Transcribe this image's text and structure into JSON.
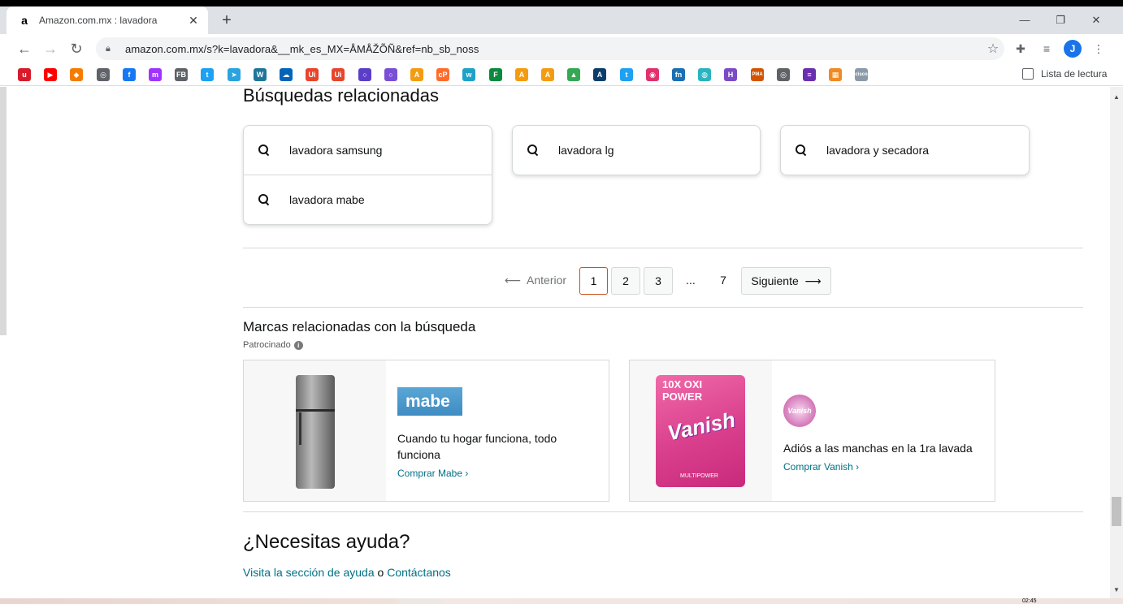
{
  "browser": {
    "tab_title": "Amazon.com.mx : lavadora",
    "tab_favicon": "a",
    "url": "amazon.com.mx/s?k=lavadora&__mk_es_MX=ÅMÅŽÕÑ&ref=nb_sb_noss",
    "profile_initial": "J",
    "reading_list": "Lista de lectura",
    "bookmarks": [
      {
        "label": "u",
        "color": "#d81b2b"
      },
      {
        "label": "▶",
        "color": "#ff0000"
      },
      {
        "label": "◆",
        "color": "#f57c00"
      },
      {
        "label": "◎",
        "color": "#5f6368"
      },
      {
        "label": "f",
        "color": "#1877f2"
      },
      {
        "label": "m",
        "color": "#a033ff"
      },
      {
        "label": "FB",
        "color": "#5f6368"
      },
      {
        "label": "t",
        "color": "#1da1f2"
      },
      {
        "label": "➤",
        "color": "#2aa3de"
      },
      {
        "label": "W",
        "color": "#21759b"
      },
      {
        "label": "☁",
        "color": "#0364b8"
      },
      {
        "label": "Ui",
        "color": "#e8452c"
      },
      {
        "label": "Ui",
        "color": "#e8452c"
      },
      {
        "label": "○",
        "color": "#5b3ec8"
      },
      {
        "label": "○",
        "color": "#7a4fd6"
      },
      {
        "label": "A",
        "color": "#f39c12"
      },
      {
        "label": "cP",
        "color": "#ff6c2c"
      },
      {
        "label": "w",
        "color": "#1fa2c7"
      },
      {
        "label": "F",
        "color": "#0b8a3e"
      },
      {
        "label": "A",
        "color": "#f39c12"
      },
      {
        "label": "A",
        "color": "#f39c12"
      },
      {
        "label": "▲",
        "color": "#34a853"
      },
      {
        "label": "A",
        "color": "#0b3d6b"
      },
      {
        "label": "t",
        "color": "#1da1f2"
      },
      {
        "label": "◉",
        "color": "#e1306c"
      },
      {
        "label": "fn",
        "color": "#1b6fb3"
      },
      {
        "label": "◍",
        "color": "#2bb3c0"
      },
      {
        "label": "H",
        "color": "#7b4ac7"
      },
      {
        "label": "PMA",
        "color": "#d35400"
      },
      {
        "label": "◎",
        "color": "#5f6368"
      },
      {
        "label": "≡",
        "color": "#6a2fb0"
      },
      {
        "label": "▦",
        "color": "#f08a24"
      },
      {
        "label": "cisco",
        "color": "#8a9aa8"
      }
    ]
  },
  "page": {
    "related_searches_heading": "Búsquedas relacionadas",
    "related_searches": [
      "lavadora samsung",
      "lavadora mabe",
      "lavadora lg",
      "lavadora y secadora"
    ],
    "pagination": {
      "prev": "Anterior",
      "pages": [
        "1",
        "2",
        "3"
      ],
      "ellipsis": "...",
      "last": "7",
      "next": "Siguiente",
      "current": "1"
    },
    "brands": {
      "title": "Marcas relacionadas con la búsqueda",
      "sponsored": "Patrocinado",
      "cards": [
        {
          "logo_text": "mabe",
          "tagline": "Cuando tu hogar funciona, todo funciona",
          "link": "Comprar Mabe ›"
        },
        {
          "logo_text": "Vanish",
          "tagline": "Adiós a las manchas en la 1ra lavada",
          "link": "Comprar Vanish ›"
        }
      ],
      "vanish_pack_top": "10X OXI POWER",
      "vanish_pack_word": "Vanish",
      "vanish_pack_sub": "MULTIPOWER"
    },
    "help": {
      "title": "¿Necesitas ayuda?",
      "link1": "Visita la sección de ayuda",
      "connector": " o ",
      "link2": "Contáctanos"
    }
  },
  "taskbar_clock": "02:45"
}
